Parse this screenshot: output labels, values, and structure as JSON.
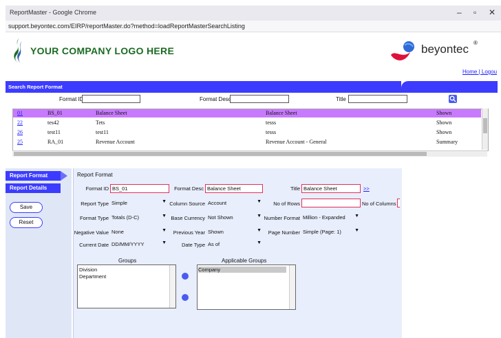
{
  "window": {
    "title": "ReportMaster - Google Chrome",
    "url": "support.beyontec.com/EIRP/reportMaster.do?method=loadReportMasterSearchListing"
  },
  "header": {
    "logo_text": "YOUR COMPANY LOGO HERE",
    "brand": "beyontec",
    "brand_reg": "®",
    "links": "Home | Logou"
  },
  "search": {
    "banner": "Search Report Format",
    "format_id_label": "Format ID",
    "format_desc_label": "Format Desc",
    "title_label": "Title"
  },
  "grid": {
    "rows": [
      {
        "id": "01",
        "code": "BS_01",
        "desc": "Balance Sheet",
        "title": "Balance Sheet",
        "display": "Shown",
        "header": true
      },
      {
        "id": "22",
        "code": "tes42",
        "desc": "Tets",
        "title": "tesss",
        "display": "Shown",
        "header": false
      },
      {
        "id": "26",
        "code": "test11",
        "desc": "test11",
        "title": "tesss",
        "display": "Shown",
        "header": false
      },
      {
        "id": "25",
        "code": "RA_01",
        "desc": "Revenue Account",
        "title": "Revenue Account - General",
        "display": "Summary",
        "header": false
      }
    ]
  },
  "left": {
    "tab_format": "Report Format",
    "tab_details": "Report Details",
    "save": "Save",
    "reset": "Reset"
  },
  "form": {
    "section_title": "Report Format",
    "format_id_label": "Format ID",
    "format_id_value": "BS_01",
    "format_desc_label": "Format Desc",
    "format_desc_value": "Balance Sheet",
    "title_label": "Title",
    "title_value": "Balance Sheet",
    "title_link": ">>",
    "report_type_label": "Report Type",
    "report_type_value": "Simple",
    "column_source_label": "Column Source",
    "column_source_value": "Account",
    "no_of_rows_label": "No of Rows",
    "no_of_columns_label": "No of Columns",
    "format_type_label": "Format Type",
    "format_type_value": "Totals (D-C)",
    "base_currency_label": "Base Currency",
    "base_currency_value": "Not Shown",
    "number_format_label": "Number Format",
    "number_format_value": "Million - Expanded",
    "negative_value_label": "Negative Value",
    "negative_value_value": "None",
    "previous_year_label": "Previous Year",
    "previous_year_value": "Shown",
    "page_number_label": "Page Number",
    "page_number_value": "Simple (Page: 1)",
    "current_date_label": "Current Date",
    "current_date_value": "DD/MM/YYYY",
    "date_type_label": "Date Type",
    "date_type_value": "As of",
    "groups_label": "Groups",
    "groups": [
      "Division",
      "Department"
    ],
    "applicable_groups_label": "Applicable Groups",
    "applicable_groups": [
      "Company"
    ]
  }
}
